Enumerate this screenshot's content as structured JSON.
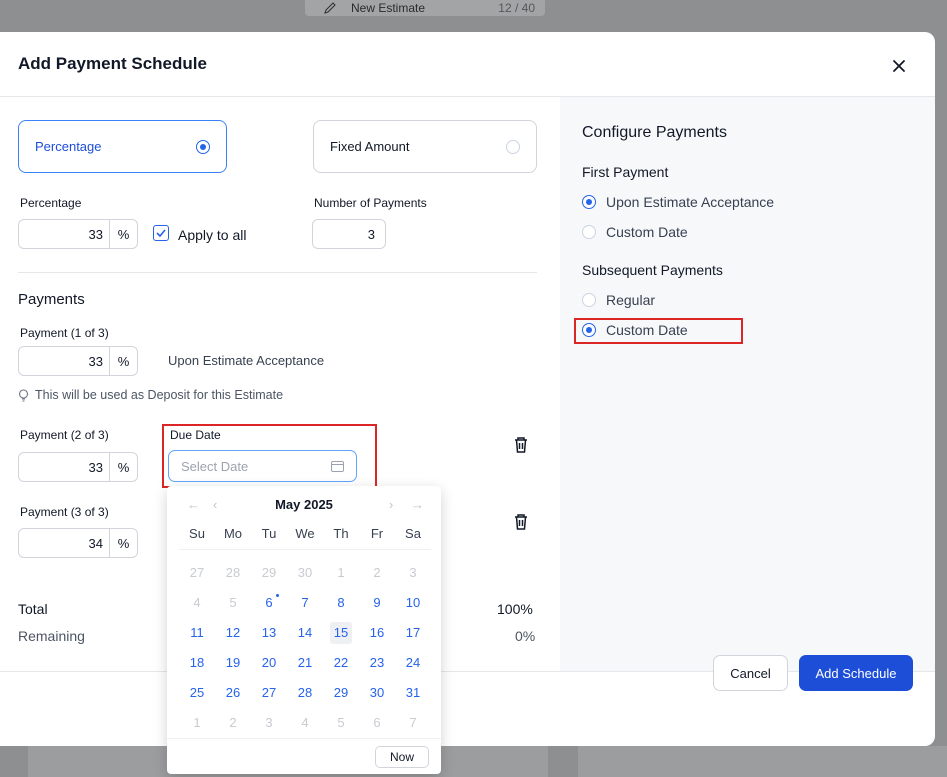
{
  "background": {
    "top_card_title": "New Estimate",
    "top_card_count": "12 / 40"
  },
  "modal": {
    "title": "Add Payment Schedule"
  },
  "type_options": {
    "percentage": {
      "label": "Percentage",
      "selected": true
    },
    "fixed": {
      "label": "Fixed Amount",
      "selected": false
    }
  },
  "percentage_field": {
    "label": "Percentage",
    "value": "33",
    "unit": "%"
  },
  "apply_all": {
    "label": "Apply to all",
    "checked": true
  },
  "num_payments": {
    "label": "Number of Payments",
    "value": "3"
  },
  "payments": {
    "title": "Payments",
    "p1": {
      "label": "Payment (1 of 3)",
      "value": "33",
      "unit": "%",
      "trigger": "Upon Estimate Acceptance"
    },
    "hint": "This will be used as Deposit for this Estimate",
    "p2": {
      "label": "Payment (2 of 3)",
      "value": "33",
      "unit": "%",
      "due_label": "Due Date",
      "due_placeholder": "Select Date"
    },
    "p3": {
      "label": "Payment (3 of 3)",
      "value": "34",
      "unit": "%"
    }
  },
  "totals": {
    "total_label": "Total",
    "total_value": "100%",
    "remaining_label": "Remaining",
    "remaining_value": "0%"
  },
  "configure": {
    "title": "Configure Payments",
    "first_title": "First Payment",
    "first_opt1": "Upon Estimate Acceptance",
    "first_opt2": "Custom Date",
    "first_selected": "Upon Estimate Acceptance",
    "subsequent_title": "Subsequent Payments",
    "sub_opt1": "Regular",
    "sub_opt2": "Custom Date",
    "sub_selected": "Custom Date"
  },
  "calendar": {
    "month_label": "May 2025",
    "weekdays": [
      "Su",
      "Mo",
      "Tu",
      "We",
      "Th",
      "Fr",
      "Sa"
    ],
    "days": [
      {
        "d": "27",
        "state": "dim"
      },
      {
        "d": "28",
        "state": "dim"
      },
      {
        "d": "29",
        "state": "dim"
      },
      {
        "d": "30",
        "state": "dim"
      },
      {
        "d": "1",
        "state": "dim"
      },
      {
        "d": "2",
        "state": "dim"
      },
      {
        "d": "3",
        "state": "dim"
      },
      {
        "d": "4",
        "state": "dim"
      },
      {
        "d": "5",
        "state": "dim"
      },
      {
        "d": "6",
        "state": "act-dot"
      },
      {
        "d": "7",
        "state": "act"
      },
      {
        "d": "8",
        "state": "act"
      },
      {
        "d": "9",
        "state": "act"
      },
      {
        "d": "10",
        "state": "act"
      },
      {
        "d": "11",
        "state": "act"
      },
      {
        "d": "12",
        "state": "act"
      },
      {
        "d": "13",
        "state": "act"
      },
      {
        "d": "14",
        "state": "act"
      },
      {
        "d": "15",
        "state": "act-today"
      },
      {
        "d": "16",
        "state": "act"
      },
      {
        "d": "17",
        "state": "act"
      },
      {
        "d": "18",
        "state": "act"
      },
      {
        "d": "19",
        "state": "act"
      },
      {
        "d": "20",
        "state": "act"
      },
      {
        "d": "21",
        "state": "act"
      },
      {
        "d": "22",
        "state": "act"
      },
      {
        "d": "23",
        "state": "act"
      },
      {
        "d": "24",
        "state": "act"
      },
      {
        "d": "25",
        "state": "act"
      },
      {
        "d": "26",
        "state": "act"
      },
      {
        "d": "27",
        "state": "act"
      },
      {
        "d": "28",
        "state": "act"
      },
      {
        "d": "29",
        "state": "act"
      },
      {
        "d": "30",
        "state": "act"
      },
      {
        "d": "31",
        "state": "act"
      },
      {
        "d": "1",
        "state": "dim"
      },
      {
        "d": "2",
        "state": "dim"
      },
      {
        "d": "3",
        "state": "dim"
      },
      {
        "d": "4",
        "state": "dim"
      },
      {
        "d": "5",
        "state": "dim"
      },
      {
        "d": "6",
        "state": "dim"
      },
      {
        "d": "7",
        "state": "dim"
      }
    ],
    "now_label": "Now"
  },
  "footer": {
    "cancel_label": "Cancel",
    "add_label": "Add Schedule"
  },
  "colors": {
    "accent": "#1d4ed8",
    "highlight": "#dc2626"
  }
}
